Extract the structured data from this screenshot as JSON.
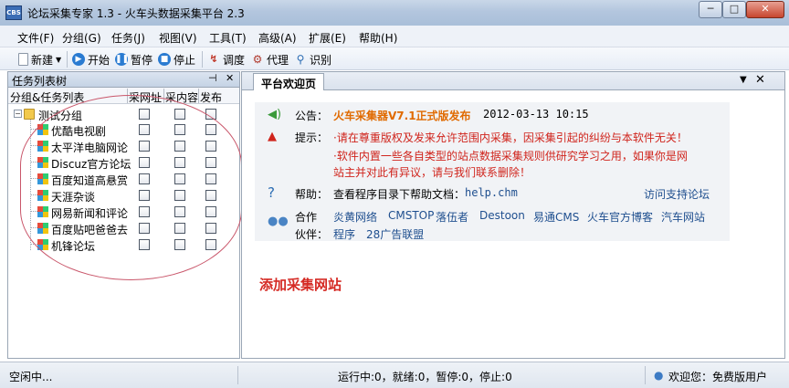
{
  "window": {
    "title": "论坛采集专家 1.3 - 火车头数据采集平台 2.3",
    "icon_text": "CBS",
    "min_label": "─",
    "max_label": "□",
    "close_label": "✕"
  },
  "menu": [
    "文件(F)",
    "分组(G)",
    "任务(J)",
    "视图(V)",
    "工具(T)",
    "高级(A)",
    "扩展(E)",
    "帮助(H)"
  ],
  "toolbar": {
    "new_label": "新建",
    "new_arrow": "▼",
    "start_label": "开始",
    "pause_label": "暂停",
    "stop_label": "停止",
    "schedule_label": "调度",
    "proxy_label": "代理",
    "recognize_label": "识别"
  },
  "task_panel": {
    "title": "任务列表树",
    "pin": "⊣",
    "close": "✕",
    "columns": [
      "分组&任务列表",
      "采网址",
      "采内容",
      "发布"
    ],
    "group": {
      "name": "测试分组",
      "expander": "−"
    },
    "tasks": [
      "优酷电视剧",
      "太平洋电脑网论",
      "Discuz官方论坛",
      "百度知道高悬赏",
      "天涯杂谈",
      "网易新闻和评论",
      "百度贴吧爸爸去",
      "机锋论坛"
    ]
  },
  "welcome": {
    "tab": "平台欢迎页",
    "dropdown": "▼",
    "close": "✕",
    "notice_label": "公告：",
    "notice_title": "火车采集器V7.1正式版发布",
    "notice_date": "2012-03-13 10:15",
    "tips_label": "提示：",
    "tips_line1": "·请在尊重版权及发来允许范围内采集，因采集引起的纠纷与本软件无关！",
    "tips_line2": "·软件内置一些各自类型的站点数据采集规则供研究学习之用，如果你是网",
    "tips_line3": "站主并对此有异议，请与我们联系删除！",
    "help_label": "帮助：",
    "help_text": "查看程序目录下帮助文档：",
    "help_file": "help.chm",
    "help_link": "访问支持论坛",
    "partner_label1": "合作",
    "partner_label2": "伙伴：",
    "partners_row1": [
      "炎黄网络",
      "CMSTOP",
      "落伍者",
      "Destoon",
      "易通CMS",
      "火车官方博客",
      "汽车网站"
    ],
    "partners_row2": [
      "程序",
      "28广告联盟"
    ],
    "annotation": "添加采集网站"
  },
  "status": {
    "idle": "空闲中...",
    "counts": "运行中:0，就绪:0，暂停:0，停止:0",
    "user": "欢迎您：免费版用户"
  },
  "colors": {
    "accent_red": "#d0241c",
    "notice_orange": "#e06a00",
    "link_blue": "#1f4f8f"
  }
}
